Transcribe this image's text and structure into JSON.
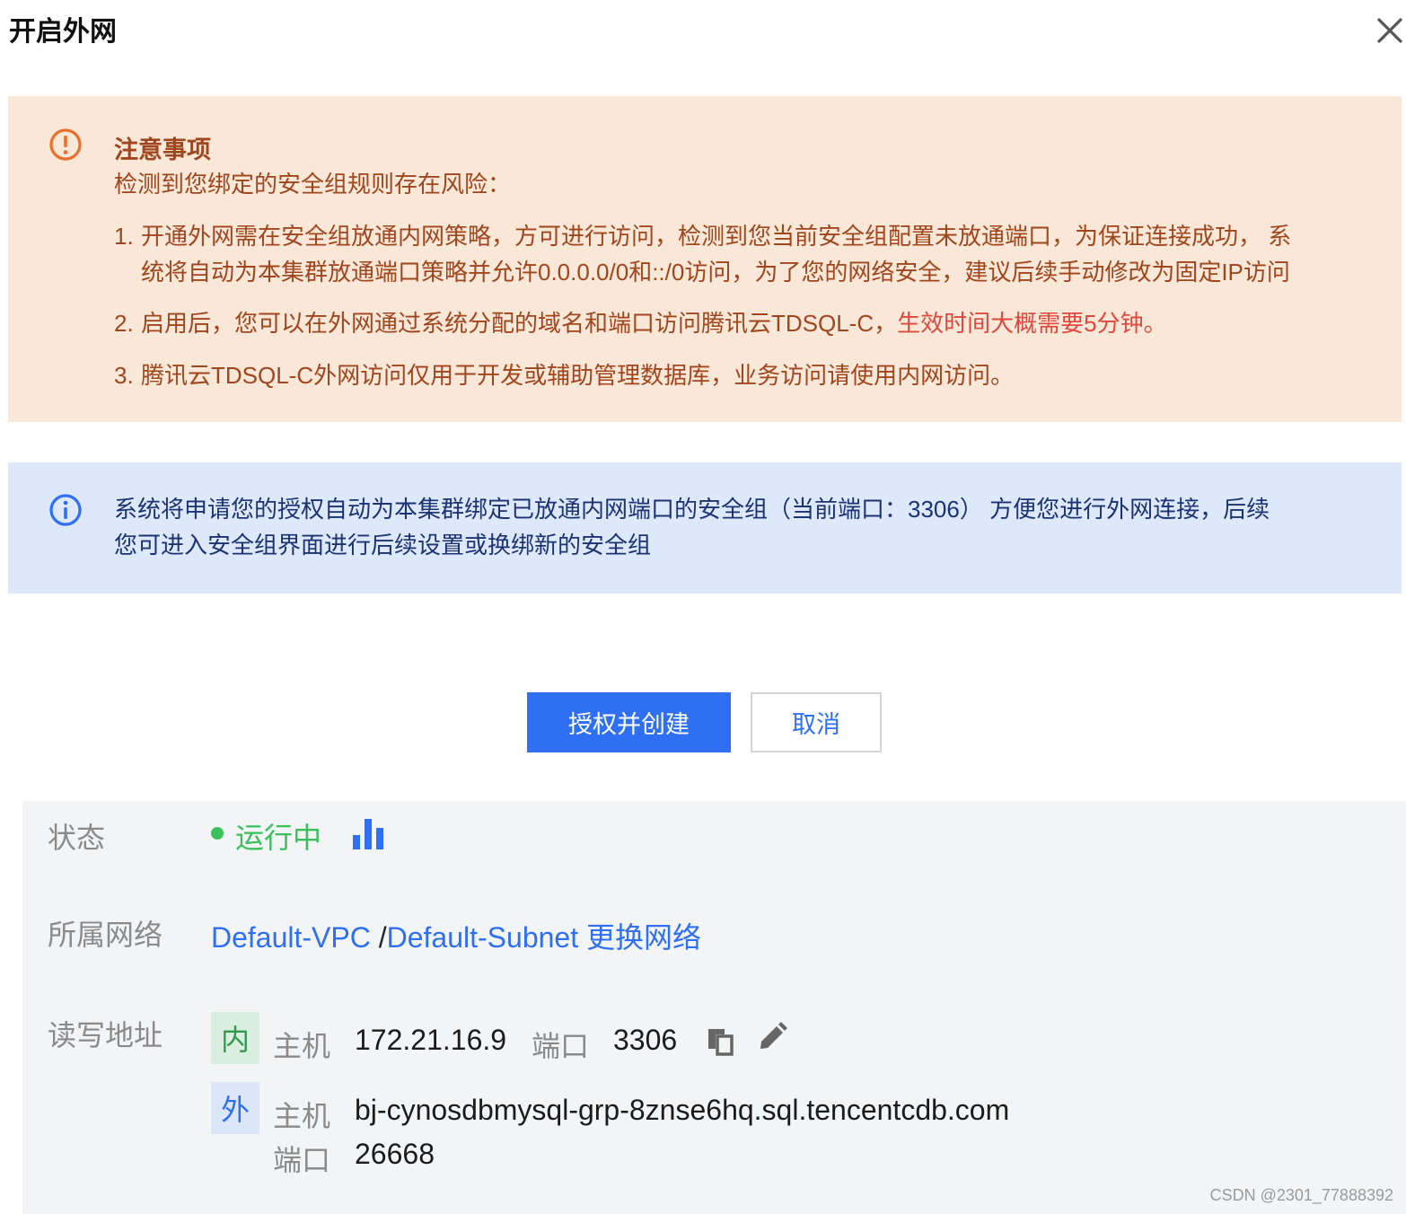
{
  "dialog": {
    "title": "开启外网"
  },
  "warning": {
    "title": "注意事项",
    "subtitle": "检测到您绑定的安全组规则存在风险：",
    "items": [
      {
        "num": "1.",
        "line1": "开通外网需在安全组放通内网策略，方可进行访问，检测到您当前安全组配置未放通端口，为保证连接成功， 系",
        "line2": "统将自动为本集群放通端口策略并允许0.0.0.0/0和::/0访问，为了您的网络安全，建议后续手动修改为固定IP访问"
      },
      {
        "num": "2.",
        "text": "启用后，您可以在外网通过系统分配的域名和端口访问腾讯云TDSQL-C，",
        "highlight": "生效时间大概需要5分钟。"
      },
      {
        "num": "3.",
        "text": "腾讯云TDSQL-C外网访问仅用于开发或辅助管理数据库，业务访问请使用内网访问。"
      }
    ]
  },
  "info": {
    "line1": "系统将申请您的授权自动为本集群绑定已放通内网端口的安全组（当前端口：3306） 方便您进行外网连接，后续",
    "line2": "您可进入安全组界面进行后续设置或换绑新的安全组"
  },
  "buttons": {
    "confirm_label": "授权并创建",
    "cancel_label": "取消"
  },
  "details": {
    "status_label": "状态",
    "status_value": "运行中",
    "network_label": "所属网络",
    "vpc": "Default-VPC",
    "separator": "/",
    "subnet": "Default-Subnet",
    "change_network": "更换网络",
    "address_label": "读写地址",
    "inner": {
      "tag": "内",
      "host_key": "主机",
      "host": "172.21.16.9",
      "port_key": "端口",
      "port": "3306"
    },
    "outer": {
      "tag": "外",
      "host_key": "主机",
      "host": "bj-cynosdbmysql-grp-8znse6hq.sql.tencentcdb.com",
      "port_key": "端口",
      "port": "26668"
    }
  },
  "watermark": "CSDN @2301_77888392",
  "colors": {
    "warning_bg": "#f9e7d7",
    "warning_text": "#a0461e",
    "warning_highlight": "#e0483e",
    "info_bg": "#dde8fb",
    "primary": "#2e6ff3",
    "status_green": "#3ac15d"
  },
  "icons": [
    "close-icon",
    "warning-icon",
    "info-icon",
    "monitor-chart-icon",
    "copy-icon",
    "edit-icon"
  ]
}
